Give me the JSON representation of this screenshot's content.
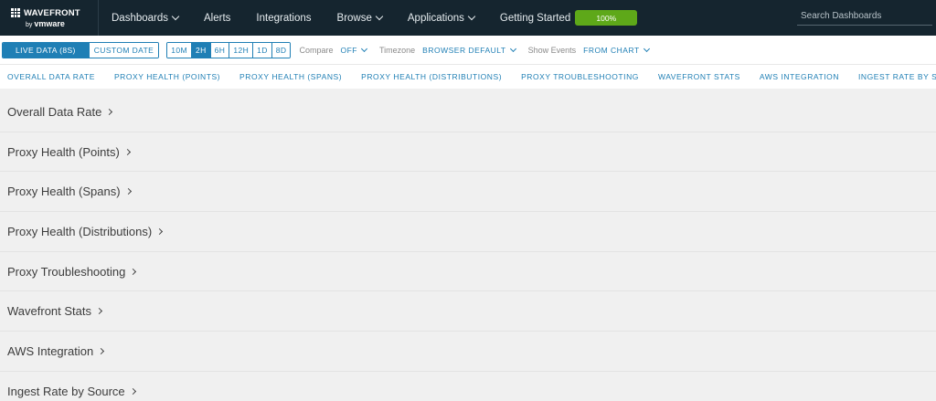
{
  "brand": {
    "name": "WAVEFRONT",
    "sub_by": "by",
    "sub_vendor": "vmware"
  },
  "nav": [
    {
      "label": "Dashboards",
      "dropdown": true
    },
    {
      "label": "Alerts",
      "dropdown": false
    },
    {
      "label": "Integrations",
      "dropdown": false
    },
    {
      "label": "Browse",
      "dropdown": true
    },
    {
      "label": "Applications",
      "dropdown": true
    },
    {
      "label": "Getting Started",
      "dropdown": false
    }
  ],
  "progress": {
    "label": "100%",
    "value": 100,
    "color": "#5ea819"
  },
  "search": {
    "placeholder": "Search Dashboards",
    "value": ""
  },
  "toolbar": {
    "live_label": "LIVE DATA (8S)",
    "custom_label": "CUSTOM DATE",
    "ranges": [
      "10M",
      "2H",
      "6H",
      "12H",
      "1D",
      "8D"
    ],
    "selected_range": "2H",
    "compare_label": "Compare",
    "compare_value": "OFF",
    "timezone_label": "Timezone",
    "timezone_value": "BROWSER DEFAULT",
    "events_label": "Show Events",
    "events_value": "FROM CHART"
  },
  "section_links": [
    "OVERALL DATA RATE",
    "PROXY HEALTH (POINTS)",
    "PROXY HEALTH (SPANS)",
    "PROXY HEALTH (DISTRIBUTIONS)",
    "PROXY TROUBLESHOOTING",
    "WAVEFRONT STATS",
    "AWS INTEGRATION",
    "INGEST RATE BY SOURCE"
  ],
  "sections": [
    "Overall Data Rate",
    "Proxy Health (Points)",
    "Proxy Health (Spans)",
    "Proxy Health (Distributions)",
    "Proxy Troubleshooting",
    "Wavefront Stats",
    "AWS Integration",
    "Ingest Rate by Source"
  ],
  "colors": {
    "nav_bg": "#15252f",
    "accent": "#1f7fb5",
    "page_bg": "#f0f0f0"
  }
}
